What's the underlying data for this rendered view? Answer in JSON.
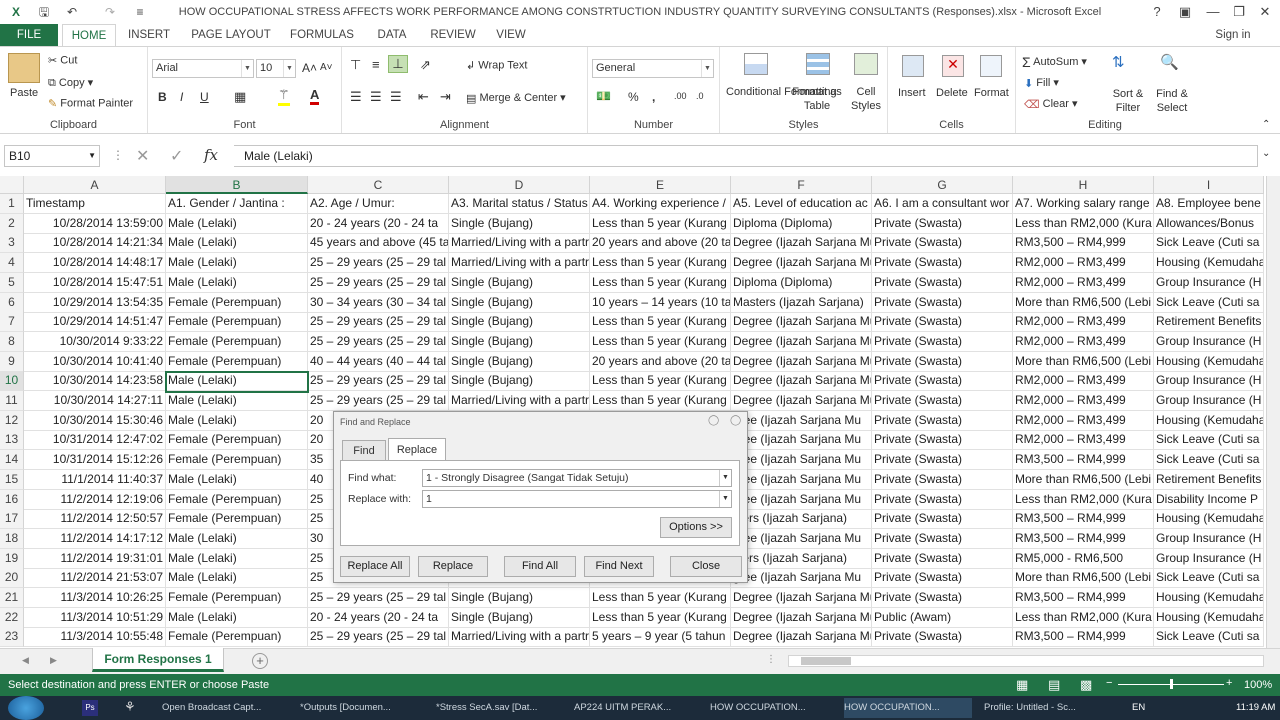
{
  "window": {
    "title": "HOW OCCUPATIONAL STRESS AFFECTS WORK PERFORMANCE AMONG CONSTRTUCTION INDUSTRY QUANTITY SURVEYING CONSULTANTS (Responses).xlsx - Microsoft Excel",
    "help": "?",
    "signin": "Sign in"
  },
  "ribbon_tabs": [
    "FILE",
    "HOME",
    "INSERT",
    "PAGE LAYOUT",
    "FORMULAS",
    "DATA",
    "REVIEW",
    "VIEW"
  ],
  "clipboard": {
    "paste": "Paste",
    "cut": "Cut",
    "copy": "Copy",
    "format_painter": "Format Painter",
    "label": "Clipboard"
  },
  "font": {
    "name": "Arial",
    "size": "10",
    "bold": "B",
    "italic": "I",
    "underline": "U",
    "label": "Font"
  },
  "alignment": {
    "wrap": "Wrap Text",
    "merge": "Merge & Center",
    "label": "Alignment"
  },
  "number": {
    "format": "General",
    "label": "Number"
  },
  "styles": {
    "conditional": "Conditional Formatting",
    "format_table": "Format as Table",
    "cell_styles": "Cell Styles",
    "label": "Styles"
  },
  "cells": {
    "insert": "Insert",
    "delete": "Delete",
    "format": "Format",
    "label": "Cells"
  },
  "editing": {
    "autosum": "AutoSum",
    "fill": "Fill",
    "clear": "Clear",
    "sort": "Sort & Filter",
    "find": "Find & Select",
    "label": "Editing"
  },
  "formula_bar": {
    "name_box": "B10",
    "content": "Male (Lelaki)",
    "fx": "fx"
  },
  "columns": [
    "A",
    "B",
    "C",
    "D",
    "E",
    "F",
    "G",
    "H",
    "I"
  ],
  "rows": [
    [
      "Timestamp",
      "A1. Gender / Jantina :",
      "A2. Age / Umur:",
      "A3. Marital status / Status",
      "A4. Working experience /",
      "A5. Level of education ac",
      "A6. I am a consultant wor",
      "A7. Working salary range",
      "A8. Employee bene"
    ],
    [
      "10/28/2014 13:59:00",
      "Male (Lelaki)",
      "20  - 24 years (20  - 24 ta",
      "Single (Bujang)",
      "Less than 5 year (Kurang",
      "Diploma (Diploma)",
      "Private (Swasta)",
      "Less than RM2,000 (Kura",
      "Allowances/Bonus"
    ],
    [
      "10/28/2014 14:21:34",
      "Male (Lelaki)",
      "45 years and above (45 ta",
      "Married/Living with a partr",
      "20 years and above (20 ta",
      "Degree (Ijazah Sarjana Mu",
      "Private (Swasta)",
      "RM3,500 – RM4,999",
      "Sick Leave (Cuti sa"
    ],
    [
      "10/28/2014 14:48:17",
      "Male (Lelaki)",
      "25 – 29 years (25 – 29 tal",
      "Married/Living with a partr",
      "Less than 5 year (Kurang",
      "Degree (Ijazah Sarjana Mu",
      "Private (Swasta)",
      "RM2,000 – RM3,499",
      "Housing (Kemudaha"
    ],
    [
      "10/28/2014 15:47:51",
      "Male (Lelaki)",
      "25 – 29 years (25 – 29 tal",
      "Single (Bujang)",
      "Less than 5 year (Kurang",
      "Diploma (Diploma)",
      "Private (Swasta)",
      "RM2,000 – RM3,499",
      "Group Insurance (H"
    ],
    [
      "10/29/2014 13:54:35",
      "Female (Perempuan)",
      "30 – 34 years (30 – 34 tal",
      "Single (Bujang)",
      "10 years – 14 years (10 ta",
      "Masters (Ijazah Sarjana)",
      "Private (Swasta)",
      "More than RM6,500 (Lebi",
      "Sick Leave (Cuti sa"
    ],
    [
      "10/29/2014 14:51:47",
      "Female (Perempuan)",
      "25 – 29 years (25 – 29 tal",
      "Single (Bujang)",
      "Less than 5 year (Kurang",
      "Degree (Ijazah Sarjana Mu",
      "Private (Swasta)",
      "RM2,000 – RM3,499",
      "Retirement Benefits"
    ],
    [
      "10/30/2014 9:33:22",
      "Female (Perempuan)",
      "25 – 29 years (25 – 29 tal",
      "Single (Bujang)",
      "Less than 5 year (Kurang",
      "Degree (Ijazah Sarjana Mu",
      "Private (Swasta)",
      "RM2,000 – RM3,499",
      "Group Insurance (H"
    ],
    [
      "10/30/2014 10:41:40",
      "Female (Perempuan)",
      "40 – 44 years (40 – 44 tal",
      "Single (Bujang)",
      "20 years and above (20 ta",
      "Degree (Ijazah Sarjana Mu",
      "Private (Swasta)",
      "More than RM6,500 (Lebi",
      "Housing (Kemudaha"
    ],
    [
      "10/30/2014 14:23:58",
      "Male (Lelaki)",
      "25 – 29 years (25 – 29 tal",
      "Single (Bujang)",
      "Less than 5 year (Kurang",
      "Degree (Ijazah Sarjana Mu",
      "Private (Swasta)",
      "RM2,000 – RM3,499",
      "Group Insurance (H"
    ],
    [
      "10/30/2014 14:27:11",
      "Male (Lelaki)",
      "25 – 29 years (25 – 29 tal",
      "Married/Living with a partr",
      "Less than 5 year (Kurang",
      "Degree (Ijazah Sarjana Mu",
      "Private (Swasta)",
      "RM2,000 – RM3,499",
      "Group Insurance (H"
    ],
    [
      "10/30/2014 15:30:46",
      "Male (Lelaki)",
      "20",
      "",
      "",
      "gree (Ijazah Sarjana Mu",
      "Private (Swasta)",
      "RM2,000 – RM3,499",
      "Housing (Kemudaha"
    ],
    [
      "10/31/2014 12:47:02",
      "Female (Perempuan)",
      "20",
      "",
      "",
      "gree (Ijazah Sarjana Mu",
      "Private (Swasta)",
      "RM2,000 – RM3,499",
      "Sick Leave (Cuti sa"
    ],
    [
      "10/31/2014 15:12:26",
      "Female (Perempuan)",
      "35",
      "",
      "",
      "gree (Ijazah Sarjana Mu",
      "Private (Swasta)",
      "RM3,500 – RM4,999",
      "Sick Leave (Cuti sa"
    ],
    [
      "11/1/2014 11:40:37",
      "Male (Lelaki)",
      "40",
      "",
      "",
      "gree (Ijazah Sarjana Mu",
      "Private (Swasta)",
      "More than RM6,500 (Lebi",
      "Retirement Benefits"
    ],
    [
      "11/2/2014 12:19:06",
      "Female (Perempuan)",
      "25",
      "",
      "",
      "gree (Ijazah Sarjana Mu",
      "Private (Swasta)",
      "Less than RM2,000 (Kura",
      "Disability Income P"
    ],
    [
      "11/2/2014 12:50:57",
      "Female (Perempuan)",
      "25",
      "",
      "",
      "sters (Ijazah Sarjana)",
      "Private (Swasta)",
      "RM3,500 – RM4,999",
      "Housing (Kemudaha"
    ],
    [
      "11/2/2014 14:17:12",
      "Male (Lelaki)",
      "30",
      "",
      "",
      "gree (Ijazah Sarjana Mu",
      "Private (Swasta)",
      "RM3,500 – RM4,999",
      "Group Insurance (H"
    ],
    [
      "11/2/2014 19:31:01",
      "Male (Lelaki)",
      "25",
      "",
      "",
      "sters (Ijazah Sarjana)",
      "Private (Swasta)",
      "RM5,000 - RM6,500",
      "Group Insurance (H"
    ],
    [
      "11/2/2014 21:53:07",
      "Male (Lelaki)",
      "25",
      "",
      "",
      "gree (Ijazah Sarjana Mu",
      "Private (Swasta)",
      "More than RM6,500 (Lebi",
      "Sick Leave (Cuti sa"
    ],
    [
      "11/3/2014 10:26:25",
      "Female (Perempuan)",
      "25 – 29 years (25 – 29 tal",
      "Single (Bujang)",
      "Less than 5 year (Kurang",
      "Degree (Ijazah Sarjana Mu",
      "Private (Swasta)",
      "RM3,500 – RM4,999",
      "Housing (Kemudaha"
    ],
    [
      "11/3/2014 10:51:29",
      "Male (Lelaki)",
      "20  - 24 years (20  - 24 ta",
      "Single (Bujang)",
      "Less than 5 year (Kurang",
      "Degree (Ijazah Sarjana Mu",
      "Public (Awam)",
      "Less than RM2,000 (Kura",
      "Housing (Kemudaha"
    ],
    [
      "11/3/2014 10:55:48",
      "Female (Perempuan)",
      "25 – 29 years (25 – 29 tal",
      "Married/Living with a partr",
      "5 years – 9 year (5 tahun",
      "Degree (Ijazah Sarjana Mu",
      "Private (Swasta)",
      "RM3,500 – RM4,999",
      "Sick Leave (Cuti sa"
    ]
  ],
  "row_numbers": [
    "1",
    "2",
    "3",
    "4",
    "5",
    "6",
    "7",
    "8",
    "9",
    "10",
    "11",
    "12",
    "13",
    "14",
    "15",
    "16",
    "17",
    "18",
    "19",
    "20",
    "21",
    "22",
    "23"
  ],
  "dialog": {
    "title": "Find and Replace",
    "tab_find": "Find",
    "tab_replace": "Replace",
    "find_label": "Find what:",
    "find_value": "1 - Strongly Disagree (Sangat Tidak Setuju)",
    "replace_label": "Replace with:",
    "replace_value": "1",
    "options": "Options >>",
    "replace_all": "Replace All",
    "replace": "Replace",
    "find_all": "Find All",
    "find_next": "Find Next",
    "close": "Close"
  },
  "sheet_tab": "Form Responses 1",
  "status": {
    "message": "Select destination and press ENTER or choose Paste",
    "zoom": "100%"
  },
  "taskbar": {
    "items": [
      "Open Broadcast Capt...",
      "*Outputs [Documen...",
      "*Stress SecA.sav [Dat...",
      "AP224 UITM PERAK...",
      "HOW OCCUPATION...",
      "HOW OCCUPATION...",
      "Profile: Untitled - Sc..."
    ],
    "lang": "EN",
    "time": "11:19 AM"
  },
  "colors": {
    "excel_green": "#217346",
    "taskbar": "#1c2b3a"
  }
}
